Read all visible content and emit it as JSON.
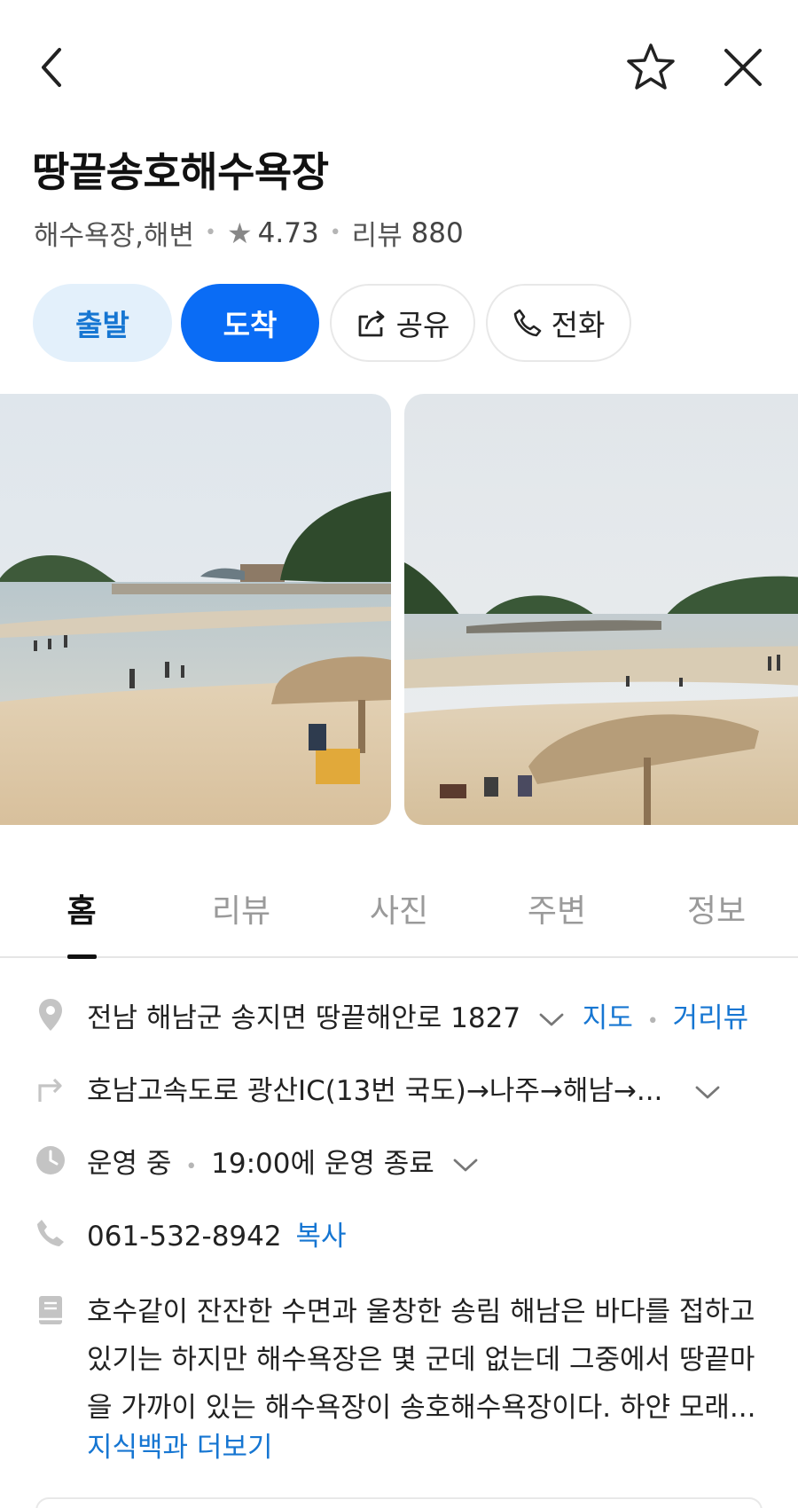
{
  "header": {
    "back_icon": "chevron-left-icon",
    "favorite_icon": "star-outline-icon",
    "close_icon": "close-icon"
  },
  "place": {
    "name": "땅끝송호해수욕장",
    "category": "해수욕장,해변",
    "rating": "4.73",
    "review_label": "리뷰",
    "review_count": "880"
  },
  "actions": {
    "depart": "출발",
    "arrive": "도착",
    "share": "공유",
    "call": "전화"
  },
  "tabs": [
    "홈",
    "리뷰",
    "사진",
    "주변",
    "정보"
  ],
  "info": {
    "address": "전남 해남군 송지면 땅끝해안로 1827",
    "map_link": "지도",
    "streetview_link": "거리뷰",
    "directions": "호남고속도로 광산IC(13번 국도)→나주→해남→...",
    "status": "운영 중",
    "hours": "19:00에 운영 종료",
    "phone": "061-532-8942",
    "copy": "복사",
    "description": "호수같이 잔잔한 수면과 울창한 송림 해남은 바다를 접하고 있기는 하지만 해수욕장은 몇 군데 없는데 그중에서 땅끝마을 가까이 있는 해수욕장이 송호해수욕장이다. 하얀 모래...",
    "more": "지식백과 더보기"
  },
  "colors": {
    "accent": "#0a6cf5",
    "accent_light": "#e3f0fb",
    "link": "#1676d2"
  }
}
